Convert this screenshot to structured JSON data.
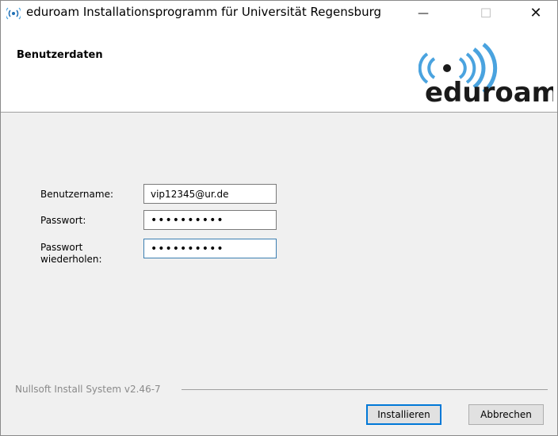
{
  "window": {
    "title": "eduroam Installationsprogramm für Universität Regensburg",
    "minimize_glyph": "—",
    "maximize_glyph": "☐",
    "close_glyph": "✕"
  },
  "header": {
    "title": "Benutzerdaten",
    "logo_text": "eduroam"
  },
  "form": {
    "username_label": "Benutzername:",
    "username_value": "vip12345@ur.de",
    "password_label": "Passwort:",
    "password_value": "••••••••••",
    "repeat_label_line1": "Passwort",
    "repeat_label_line2": "wiederholen:",
    "repeat_value": "••••••••••"
  },
  "footer": {
    "branding": "Nullsoft Install System v2.46-7",
    "install_label": "Installieren",
    "cancel_label": "Abbrechen"
  },
  "colors": {
    "logo_arc": "#4aa3df",
    "logo_text_dark": "#1a1a1a",
    "logo_text_blue": "#1f6fb5",
    "focus_border": "#3c7fb1",
    "default_button_border": "#0078d7"
  }
}
